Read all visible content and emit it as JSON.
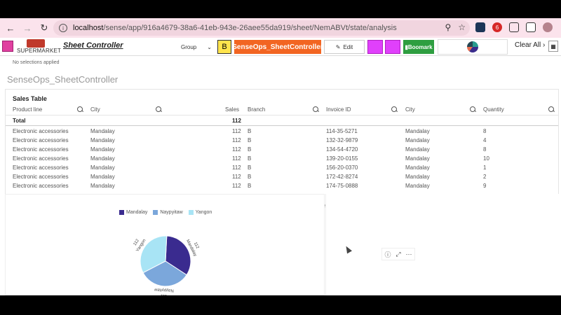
{
  "browser": {
    "url_host": "localhost",
    "url_path": "/sense/app/916a4679-38a6-41eb-943e-26aee55da919/sheet/NemABVt/state/analysis",
    "ext_badge": "6"
  },
  "toolbar": {
    "logo_text": "SUPERMARKET",
    "sheet_controller": "Sheet Controller",
    "group_label": "Group",
    "b_label": "B",
    "senseops_label": "SenseOps_SheetController",
    "edit_label": "Edit",
    "bookmark_label": "Boomark",
    "clear_all": "Clear All"
  },
  "selections": {
    "text": "No selections applied"
  },
  "sheet": {
    "title": "SenseOps_SheetController"
  },
  "table": {
    "title": "Sales Table",
    "headers": [
      "Product line",
      "City",
      "Sales",
      "Branch",
      "Invoice ID",
      "City",
      "Quantity"
    ],
    "total": {
      "label": "Total",
      "sales": "112"
    },
    "rows": [
      [
        "Electronic accessories",
        "Mandalay",
        "112",
        "B",
        "114-35-5271",
        "Mandalay",
        "8"
      ],
      [
        "Electronic accessories",
        "Mandalay",
        "112",
        "B",
        "132-32-9879",
        "Mandalay",
        "4"
      ],
      [
        "Electronic accessories",
        "Mandalay",
        "112",
        "B",
        "134-54-4720",
        "Mandalay",
        "8"
      ],
      [
        "Electronic accessories",
        "Mandalay",
        "112",
        "B",
        "139-20-0155",
        "Mandalay",
        "10"
      ],
      [
        "Electronic accessories",
        "Mandalay",
        "112",
        "B",
        "156-20-0370",
        "Mandalay",
        "1"
      ],
      [
        "Electronic accessories",
        "Mandalay",
        "112",
        "B",
        "172-42-8274",
        "Mandalay",
        "2"
      ],
      [
        "Electronic accessories",
        "Mandalay",
        "112",
        "B",
        "174-75-0888",
        "Mandalay",
        "9"
      ]
    ]
  },
  "chart_data": {
    "type": "pie",
    "legend": [
      "Mandalay",
      "Naypyitaw",
      "Yangon"
    ],
    "colors": [
      "#3a2b8f",
      "#7ba7db",
      "#a8e4f5"
    ],
    "slices": [
      {
        "label": "Mandalay",
        "value": 112
      },
      {
        "label": "Naypyitaw",
        "value": 111
      },
      {
        "label": "Yangon",
        "value": 112
      }
    ],
    "slice_value_labels": [
      "112",
      "111",
      "112"
    ],
    "legend_position": "top"
  },
  "colors": {
    "senseops": "#f26522",
    "bookmark": "#2e9e40",
    "b_button": "#ffe44d",
    "magenta": "#e040fb"
  }
}
